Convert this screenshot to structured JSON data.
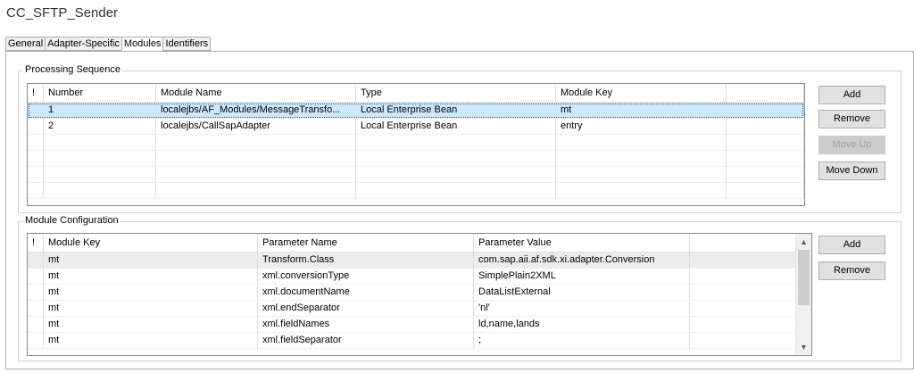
{
  "window": {
    "title": "CC_SFTP_Sender"
  },
  "tabs": [
    "General",
    "Adapter-Specific",
    "Modules",
    "Identifiers"
  ],
  "active_tab": "Modules",
  "processing_sequence": {
    "label": "Processing Sequence",
    "columns": [
      "!",
      "Number",
      "Module Name",
      "Type",
      "Module Key"
    ],
    "rows": [
      {
        "flag": "",
        "number": "1",
        "module_name": "localejbs/AF_Modules/MessageTransfo...",
        "type": "Local Enterprise Bean",
        "module_key": "mt",
        "selected": true
      },
      {
        "flag": "",
        "number": "2",
        "module_name": "localejbs/CallSapAdapter",
        "type": "Local Enterprise Bean",
        "module_key": "entry",
        "selected": false
      }
    ],
    "buttons": {
      "add": "Add",
      "remove": "Remove",
      "move_up": "Move Up",
      "move_down": "Move Down"
    }
  },
  "module_configuration": {
    "label": "Module Configuration",
    "columns": [
      "!",
      "Module Key",
      "Parameter Name",
      "Parameter Value"
    ],
    "rows": [
      {
        "flag": "",
        "module_key": "mt",
        "parameter_name": "Transform.Class",
        "parameter_value": "com.sap.aii.af.sdk.xi.adapter.Conversion",
        "highlight": true
      },
      {
        "flag": "",
        "module_key": "mt",
        "parameter_name": "xml.conversionType",
        "parameter_value": "SimplePlain2XML"
      },
      {
        "flag": "",
        "module_key": "mt",
        "parameter_name": "xml.documentName",
        "parameter_value": "DataListExternal"
      },
      {
        "flag": "",
        "module_key": "mt",
        "parameter_name": "xml.endSeparator",
        "parameter_value": "'nl'"
      },
      {
        "flag": "",
        "module_key": "mt",
        "parameter_name": "xml.fieldNames",
        "parameter_value": "ld,name,lands"
      },
      {
        "flag": "",
        "module_key": "mt",
        "parameter_name": "xml.fieldSeparator",
        "parameter_value": ";"
      }
    ],
    "buttons": {
      "add": "Add",
      "remove": "Remove"
    },
    "scrollbar": {
      "up_icon": "chevron-up-icon",
      "down_icon": "chevron-down-icon"
    }
  }
}
